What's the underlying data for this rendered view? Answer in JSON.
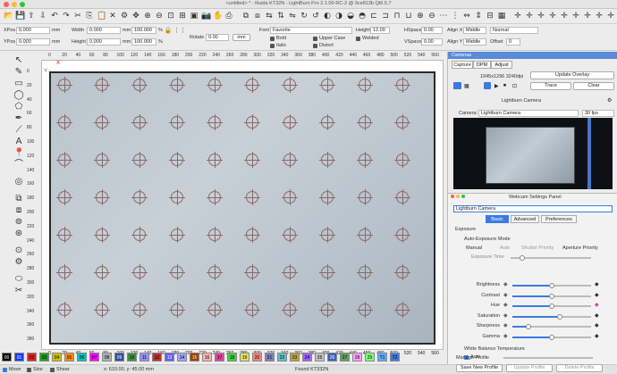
{
  "window": {
    "title": "<untitled> * - Ruida KT32N - LightBurn Pro 2.1.00-RC-2 @ 9ce813b Qt6.5.7"
  },
  "props": {
    "xpos_label": "XPos",
    "xpos": "0.000",
    "ypos_label": "YPos",
    "ypos": "0.000",
    "unit": "mm",
    "width_label": "Width",
    "width": "0.000",
    "height_label": "Height",
    "height": "0.000",
    "wpct": "100.000",
    "hpct": "100.000",
    "pct": "%",
    "rotate_label": "Rotate",
    "rotate": "0.00",
    "rot_unit": "mm",
    "font_label": "Font",
    "font": "Favorite",
    "fheight_label": "Height",
    "fheight": "12.00",
    "bold": "Bold",
    "italic": "Italic",
    "upper": "Upper Case",
    "distort": "Distort",
    "welded": "Welded",
    "hspace_label": "HSpace",
    "hspace": "0.00",
    "vspace_label": "VSpace",
    "vspace": "0.00",
    "alignx_label": "Align X",
    "alignx": "Middle",
    "aligny_label": "Align Y",
    "aligny": "Middle",
    "offset_label": "Offset",
    "offset": "0",
    "mode": "Normal"
  },
  "ruler": {
    "top": [
      "0",
      "20",
      "40",
      "60",
      "80",
      "100",
      "120",
      "140",
      "160",
      "180",
      "200",
      "220",
      "240",
      "260",
      "280",
      "300",
      "320",
      "340",
      "360",
      "380",
      "400",
      "420",
      "440",
      "460",
      "480",
      "500",
      "520",
      "540",
      "560"
    ],
    "left": [
      "0",
      "20",
      "40",
      "60",
      "80",
      "100",
      "120",
      "140",
      "160",
      "180",
      "200",
      "220",
      "240",
      "260",
      "280",
      "300",
      "320",
      "340",
      "360",
      "380"
    ],
    "bottom": [
      "0",
      "20",
      "40",
      "60",
      "80",
      "100",
      "120",
      "140",
      "160",
      "180",
      "200",
      "220",
      "240",
      "260",
      "280",
      "300",
      "320",
      "340",
      "360",
      "380",
      "400",
      "420",
      "440",
      "460",
      "480",
      "500",
      "520",
      "540",
      "560"
    ],
    "axis_x": "X",
    "axis_y": "Y"
  },
  "palette": [
    {
      "n": "00",
      "c": "#000000"
    },
    {
      "n": "01",
      "c": "#1a3cff"
    },
    {
      "n": "02",
      "c": "#e02020"
    },
    {
      "n": "03",
      "c": "#20a020"
    },
    {
      "n": "04",
      "c": "#d0c000"
    },
    {
      "n": "05",
      "c": "#ff8c00"
    },
    {
      "n": "06",
      "c": "#00c0c0"
    },
    {
      "n": "07",
      "c": "#ff00ff"
    },
    {
      "n": "08",
      "c": "#b0b0b0"
    },
    {
      "n": "09",
      "c": "#3050a0"
    },
    {
      "n": "10",
      "c": "#409040"
    },
    {
      "n": "11",
      "c": "#9090ff"
    },
    {
      "n": "12",
      "c": "#c03030"
    },
    {
      "n": "13",
      "c": "#6060ff"
    },
    {
      "n": "14",
      "c": "#a0a0ff"
    },
    {
      "n": "15",
      "c": "#a04000"
    },
    {
      "n": "16",
      "c": "#ffb0b0"
    },
    {
      "n": "17",
      "c": "#e040a0"
    },
    {
      "n": "18",
      "c": "#40d040"
    },
    {
      "n": "19",
      "c": "#e0e060"
    },
    {
      "n": "20",
      "c": "#ff8080"
    },
    {
      "n": "21",
      "c": "#8080c0"
    },
    {
      "n": "22",
      "c": "#60c0c0"
    },
    {
      "n": "23",
      "c": "#c0a040"
    },
    {
      "n": "24",
      "c": "#a060ff"
    },
    {
      "n": "25",
      "c": "#c0c0c0"
    },
    {
      "n": "26",
      "c": "#4060c0"
    },
    {
      "n": "27",
      "c": "#60a060"
    },
    {
      "n": "28",
      "c": "#ffa0ff"
    },
    {
      "n": "29",
      "c": "#80ff80"
    },
    {
      "n": "T1",
      "c": "#5fa8ff"
    },
    {
      "n": "T2",
      "c": "#3b7be0"
    }
  ],
  "status": {
    "move": "Move",
    "size": "Size",
    "shear": "Shear",
    "coords": "x: 610.00, y: 45.00 mm",
    "found": "Found KT332N"
  },
  "panel": {
    "header": "Cameras",
    "tabs": [
      "Capture",
      "DPM",
      "Adjust"
    ],
    "resolution": "1945x1296 3240dpi",
    "update_overlay": "Update Overlay",
    "trace": "Trace",
    "clear": "Clear",
    "camera_title": "Lightburn Camera",
    "camera_label": "Camera:",
    "camera": "Lightburn Camera",
    "fps": "30 fps"
  },
  "webcam": {
    "title": "Webcam Settings Panel",
    "device": "Lightburn Camera",
    "tabs": [
      "Basic",
      "Advanced",
      "Preferences"
    ],
    "exposure": "Exposure",
    "auto_exposure_mode": "Auto-Exposure Mode",
    "modes": [
      "Manual",
      "Auto",
      "Shutter Priority",
      "Aperture Priority"
    ],
    "exposure_time": "Exposure Time",
    "sliders": [
      {
        "label": "Brightness",
        "value": 0.5
      },
      {
        "label": "Contrast",
        "value": 0.5
      },
      {
        "label": "Hue",
        "value": 0.5
      },
      {
        "label": "Saturation",
        "value": 0.6
      },
      {
        "label": "Sharpness",
        "value": 0.2
      },
      {
        "label": "Gamma",
        "value": 0.5
      }
    ],
    "wb": "White Balance Temperature",
    "auto": "Auto",
    "manage": "Manage Profile",
    "save": "Save New Profile",
    "update": "Update Profile",
    "delete": "Delete Profile"
  }
}
